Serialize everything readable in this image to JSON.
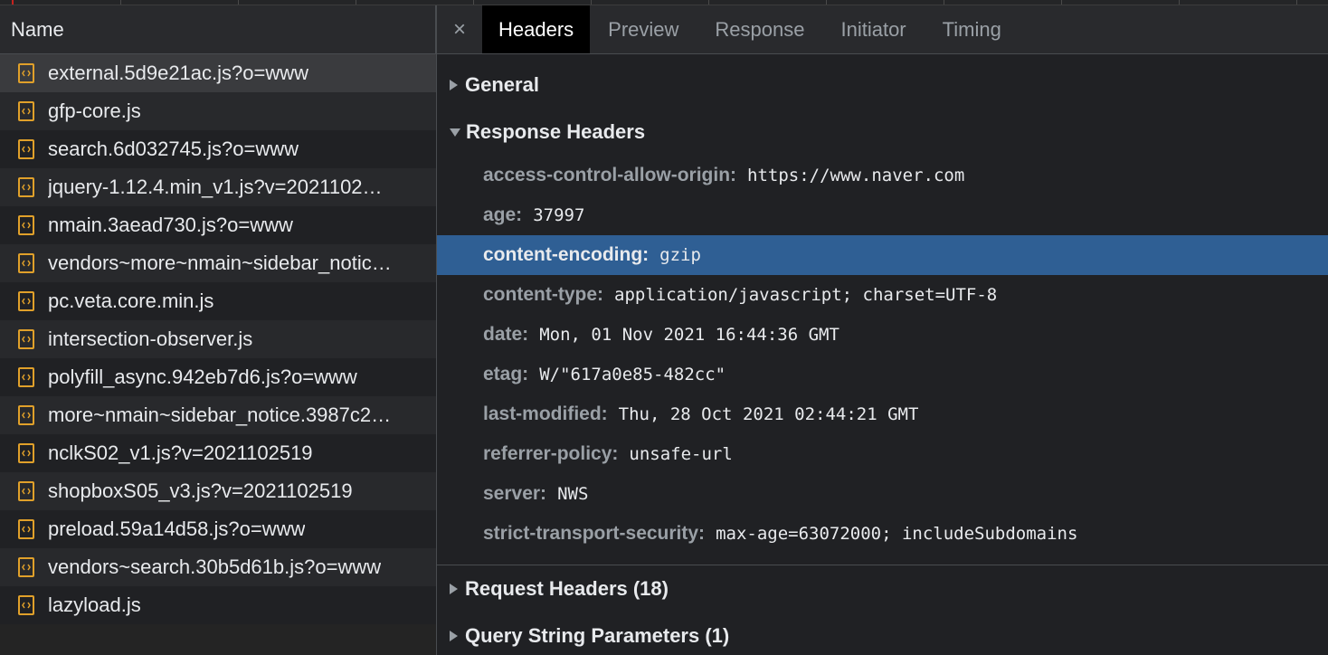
{
  "left_pane": {
    "column_header": "Name",
    "requests": [
      {
        "name": "external.5d9e21ac.js?o=www",
        "selected": true
      },
      {
        "name": "gfp-core.js"
      },
      {
        "name": "search.6d032745.js?o=www"
      },
      {
        "name": "jquery-1.12.4.min_v1.js?v=2021102…"
      },
      {
        "name": "nmain.3aead730.js?o=www"
      },
      {
        "name": "vendors~more~nmain~sidebar_notic…"
      },
      {
        "name": "pc.veta.core.min.js"
      },
      {
        "name": "intersection-observer.js"
      },
      {
        "name": "polyfill_async.942eb7d6.js?o=www"
      },
      {
        "name": "more~nmain~sidebar_notice.3987c2…"
      },
      {
        "name": "nclkS02_v1.js?v=2021102519"
      },
      {
        "name": "shopboxS05_v3.js?v=2021102519"
      },
      {
        "name": "preload.59a14d58.js?o=www"
      },
      {
        "name": "vendors~search.30b5d61b.js?o=www"
      },
      {
        "name": "lazyload.js"
      }
    ],
    "request_icon": "script-file-icon"
  },
  "tabs": {
    "close_icon": "close-icon",
    "close_label": "×",
    "items": [
      {
        "label": "Headers",
        "active": true
      },
      {
        "label": "Preview"
      },
      {
        "label": "Response"
      },
      {
        "label": "Initiator"
      },
      {
        "label": "Timing"
      }
    ]
  },
  "sections": {
    "general": {
      "label": "General",
      "expanded": false
    },
    "response_headers": {
      "label": "Response Headers",
      "expanded": true,
      "rows": [
        {
          "key": "access-control-allow-origin:",
          "value": "https://www.naver.com"
        },
        {
          "key": "age:",
          "value": "37997"
        },
        {
          "key": "content-encoding:",
          "value": "gzip",
          "selected": true
        },
        {
          "key": "content-type:",
          "value": "application/javascript; charset=UTF-8"
        },
        {
          "key": "date:",
          "value": "Mon, 01 Nov 2021 16:44:36 GMT"
        },
        {
          "key": "etag:",
          "value": "W/\"617a0e85-482cc\""
        },
        {
          "key": "last-modified:",
          "value": "Thu, 28 Oct 2021 02:44:21 GMT"
        },
        {
          "key": "referrer-policy:",
          "value": "unsafe-url"
        },
        {
          "key": "server:",
          "value": "NWS"
        },
        {
          "key": "strict-transport-security:",
          "value": "max-age=63072000; includeSubdomains"
        }
      ]
    },
    "request_headers": {
      "label": "Request Headers (18)",
      "expanded": false
    },
    "query_string": {
      "label": "Query String Parameters (1)",
      "expanded": false
    }
  },
  "colors": {
    "selected_row": "#2f5f94",
    "icon_accent": "#e0a02a",
    "background": "#202124"
  }
}
